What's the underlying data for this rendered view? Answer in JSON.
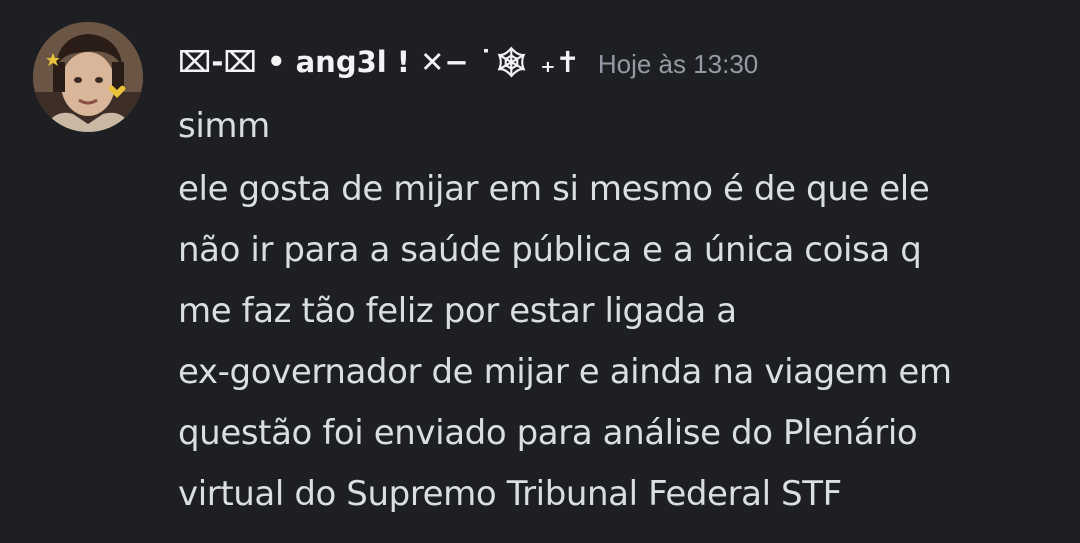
{
  "message": {
    "author": {
      "name": "⌧-⌧ • ang3l ! ✕− ˙🕸 ₊✝",
      "avatar_icon": "profile-photo-avatar"
    },
    "timestamp": "Hoje às 13:30",
    "lines": [
      "simm",
      "ele gosta de mijar em si mesmo é de que ele",
      "não ir para a saúde pública e a única coisa q",
      "me faz tão feliz por estar ligada a",
      "ex-governador de mijar e ainda na viagem em",
      "questão foi enviado para análise do Plenário",
      "virtual do Supremo Tribunal Federal STF"
    ]
  },
  "colors": {
    "background": "#1e1f22",
    "username": "#f2f3f5",
    "timestamp": "#949ba4",
    "message_text": "#dbdee1"
  }
}
